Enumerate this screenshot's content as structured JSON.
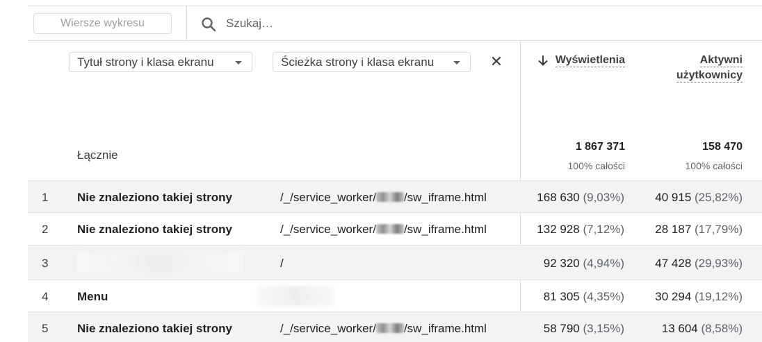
{
  "toolbar": {
    "chart_rows_label": "Wiersze wykresu",
    "search_placeholder": "Szukaj…",
    "search_icon": "search-icon"
  },
  "dimensions": {
    "primary": "Tytuł strony i klasa ekranu",
    "secondary": "Ścieżka strony i klasa ekranu",
    "remove_icon": "close-icon"
  },
  "metrics": {
    "views": {
      "label": "Wyświetlenia",
      "sort_icon": "arrow-down-icon"
    },
    "active_users": {
      "label_line1": "Aktywni",
      "label_line2": "użytkownicy"
    }
  },
  "totals": {
    "label": "Łącznie",
    "views": "1 867 371",
    "views_pct": "100% całości",
    "users": "158 470",
    "users_pct": "100% całości"
  },
  "rows": [
    {
      "idx": "1",
      "title": "Nie znaleziono takiej strony",
      "path_prefix": "/_/service_worker/",
      "path_suffix": "/sw_iframe.html",
      "views": "168 630",
      "views_pct": "(9,03%)",
      "users": "40 915",
      "users_pct": "(25,82%)"
    },
    {
      "idx": "2",
      "title": "Nie znaleziono takiej strony",
      "path_prefix": "/_/service_worker/",
      "path_suffix": "/sw_iframe.html",
      "views": "132 928",
      "views_pct": "(7,12%)",
      "users": "28 187",
      "users_pct": "(17,79%)"
    },
    {
      "idx": "3",
      "title": "",
      "path_prefix": "/",
      "path_suffix": "",
      "views": "92 320",
      "views_pct": "(4,94%)",
      "users": "47 428",
      "users_pct": "(29,93%)"
    },
    {
      "idx": "4",
      "title": "Menu",
      "path_prefix": "",
      "path_suffix": "",
      "views": "81 305",
      "views_pct": "(4,35%)",
      "users": "30 294",
      "users_pct": "(19,12%)"
    },
    {
      "idx": "5",
      "title": "Nie znaleziono takiej strony",
      "path_prefix": "/_/service_worker/",
      "path_suffix": "/sw_iframe.html",
      "views": "58 790",
      "views_pct": "(3,15%)",
      "users": "13 604",
      "users_pct": "(8,58%)"
    }
  ]
}
